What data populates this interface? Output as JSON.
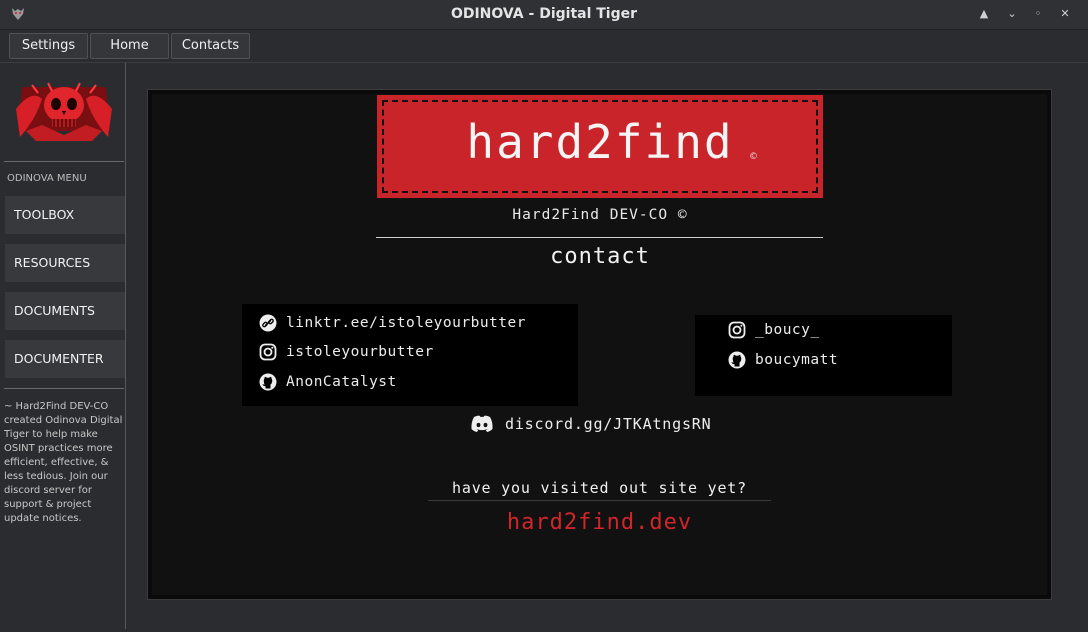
{
  "window": {
    "title": "ODINOVA - Digital Tiger",
    "controls": {
      "minimize": "▲",
      "maximize": "⌄",
      "restore": "◦",
      "close": "✕"
    }
  },
  "menubar": {
    "settings": "Settings",
    "home": "Home",
    "contacts": "Contacts"
  },
  "sidebar": {
    "menu_label": "ODINOVA MENU",
    "items": [
      {
        "label": "TOOLBOX"
      },
      {
        "label": "RESOURCES"
      },
      {
        "label": "DOCUMENTS"
      },
      {
        "label": "DOCUMENTER"
      }
    ],
    "description": "~ Hard2Find DEV-CO created Odinova Digital Tiger to help make OSINT practices more efficient, effective, & less tedious. Join our discord server for support & project update notices."
  },
  "content": {
    "banner_text": "hard2find",
    "banner_mark": "©",
    "subtitle": "Hard2Find DEV-CO ©",
    "heading": "contact",
    "left_box": [
      {
        "icon": "link-icon",
        "text": "linktr.ee/istoleyourbutter"
      },
      {
        "icon": "instagram-icon",
        "text": "istoleyourbutter"
      },
      {
        "icon": "github-icon",
        "text": "AnonCatalyst"
      }
    ],
    "right_box": [
      {
        "icon": "instagram-icon",
        "text": "_boucy_"
      },
      {
        "icon": "github-icon",
        "text": "boucymatt"
      }
    ],
    "discord": {
      "icon": "discord-icon",
      "text": "discord.gg/JTKAtngsRN"
    },
    "question": "have you visited out site yet?",
    "site": "hard2find.dev"
  },
  "colors": {
    "accent_red": "#c8242a",
    "link_red": "#d0252b",
    "background": "#2a2c2f",
    "panel": "#111111"
  }
}
